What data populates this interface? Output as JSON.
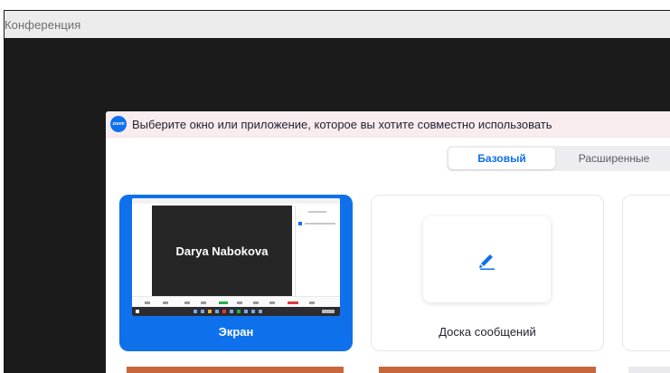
{
  "window": {
    "title": "Конференция"
  },
  "meeting": {
    "participant_name": "Darya Nabokova"
  },
  "dialog": {
    "logo_text": "zoom",
    "title": "Выберите окно или приложение, которое вы хотите совместно использовать",
    "tabs": [
      {
        "label": "Базовый",
        "selected": true
      },
      {
        "label": "Расширенные",
        "selected": false
      }
    ],
    "options": [
      {
        "label": "Экран",
        "selected": true
      },
      {
        "label": "Доска сообщений",
        "selected": false
      }
    ]
  },
  "colors": {
    "accent": "#0e71eb",
    "dialog_header": "#f8ecee",
    "meeting_bg": "#1b1b1b"
  },
  "icons": {
    "logo": "zoom-logo-icon",
    "whiteboard": "pen-icon"
  }
}
